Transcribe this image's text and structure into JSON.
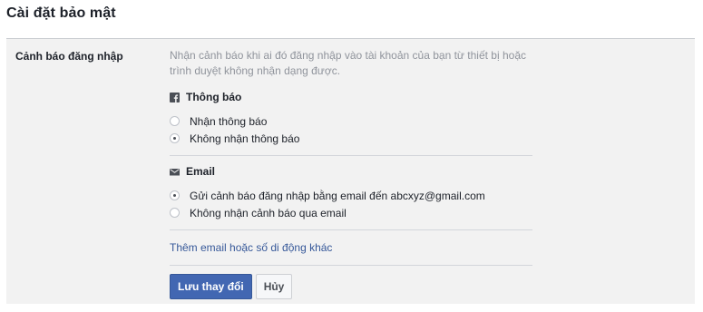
{
  "page": {
    "title": "Cài đặt bảo mật"
  },
  "section": {
    "label": "Cảnh báo đăng nhập",
    "description": "Nhận cảnh báo khi ai đó đăng nhập vào tài khoản của bạn từ thiết bị hoặc trình duyệt không nhận dạng được."
  },
  "notifications": {
    "icon": "facebook-icon",
    "title": "Thông báo",
    "options": [
      {
        "label": "Nhận thông báo",
        "checked": false
      },
      {
        "label": "Không nhận thông báo",
        "checked": true
      }
    ]
  },
  "email": {
    "icon": "envelope-icon",
    "title": "Email",
    "options": [
      {
        "label": "Gửi cảnh báo đăng nhập bằng email đến abcxyz@gmail.com",
        "checked": true
      },
      {
        "label": "Không nhận cảnh báo qua email",
        "checked": false
      }
    ]
  },
  "add_contact_link": "Thêm email hoặc số di động khác",
  "buttons": {
    "save_label": "Lưu thay đổi",
    "cancel_label": "Hủy"
  },
  "colors": {
    "primary_button": "#4267b2",
    "link": "#365899",
    "panel_background": "#f2f2f2"
  }
}
